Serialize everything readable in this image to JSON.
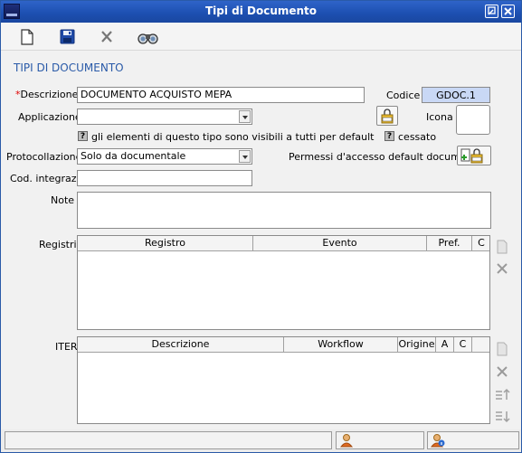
{
  "window": {
    "title": "Tipi di Documento",
    "icons": [
      "minimize-icon",
      "close-icon"
    ]
  },
  "toolbar": {
    "buttons": [
      "new-document-icon",
      "save-icon",
      "delete-icon",
      "search-binoculars-icon"
    ]
  },
  "section_title": "TIPI DI DOCUMENTO",
  "form": {
    "descrizione": {
      "required_mark": "*",
      "label": "Descrizione",
      "value": "DOCUMENTO ACQUISTO MEPA"
    },
    "codice": {
      "label": "Codice",
      "value": "GDOC.1"
    },
    "applicazione": {
      "label": "Applicazione",
      "value": ""
    },
    "icona": {
      "label": "Icona"
    },
    "visibili": {
      "help": "?",
      "label": "gli elementi di questo tipo sono visibili a tutti per default"
    },
    "cessato": {
      "help": "?",
      "label": "cessato"
    },
    "protocollazione": {
      "label": "Protocollazione",
      "value": "Solo da documentale"
    },
    "permessi": {
      "label": "Permessi d'accesso default documenti"
    },
    "cod_integraz": {
      "label": "Cod. integraz.",
      "value": ""
    },
    "note": {
      "label": "Note",
      "value": ""
    }
  },
  "registri": {
    "label": "Registri",
    "columns": [
      "Registro",
      "Evento",
      "Pref.",
      "C"
    ],
    "rows": []
  },
  "iter": {
    "label": "ITER",
    "columns": [
      "Descrizione",
      "Workflow",
      "Origine",
      "A",
      "C"
    ],
    "rows": []
  },
  "colors": {
    "title_bar": "#1c4fb0",
    "section_title": "#2a5aa8",
    "required": "#e00000",
    "code_field_bg": "#c9d8f5"
  }
}
